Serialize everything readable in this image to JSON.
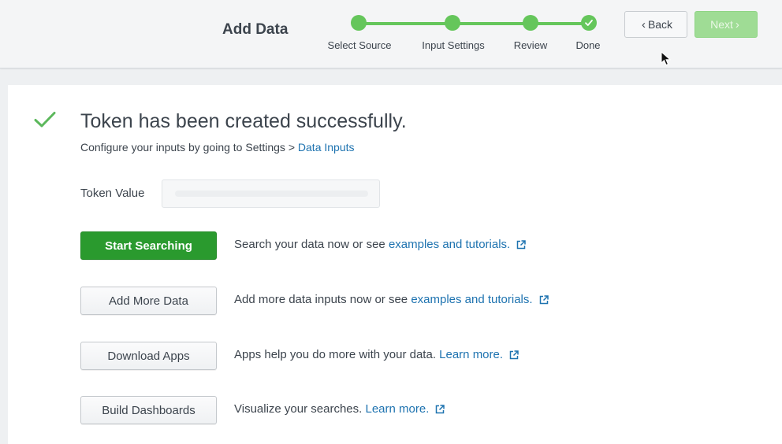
{
  "header": {
    "title": "Add Data",
    "steps": [
      {
        "label": "Select Source"
      },
      {
        "label": "Input Settings"
      },
      {
        "label": "Review"
      },
      {
        "label": "Done"
      }
    ],
    "back_label": "Back",
    "next_label": "Next"
  },
  "main": {
    "title": "Token has been created successfully.",
    "subtitle_text": "Configure your inputs by going to Settings > ",
    "subtitle_link": "Data Inputs",
    "token_label": "Token Value",
    "token_value": "",
    "actions": [
      {
        "button": "Start Searching",
        "text": "Search your data now or see ",
        "link": "examples and tutorials."
      },
      {
        "button": "Add More Data",
        "text": "Add more data inputs now or see ",
        "link": "examples and tutorials."
      },
      {
        "button": "Download Apps",
        "text": "Apps help you do more with your data. ",
        "link": "Learn more."
      },
      {
        "button": "Build Dashboards",
        "text": "Visualize your searches. ",
        "link": "Learn more."
      }
    ]
  },
  "colors": {
    "accent_green": "#65c65b",
    "primary_button": "#2a9a2e",
    "link": "#1e73b0",
    "next_disabled": "#9fdc95"
  },
  "icons": [
    "chevron-left-icon",
    "chevron-right-icon",
    "checkmark-icon",
    "external-link-icon",
    "mouse-cursor-icon"
  ]
}
